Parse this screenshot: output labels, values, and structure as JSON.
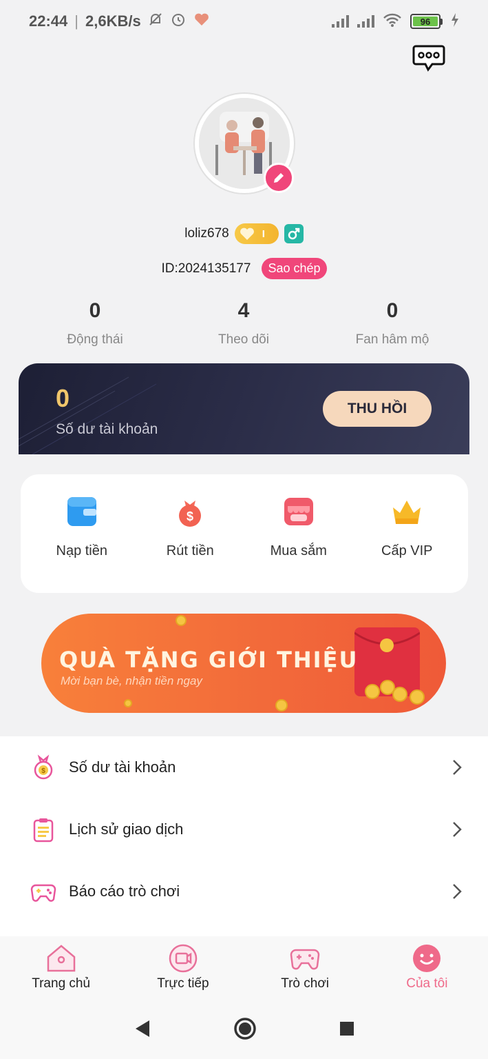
{
  "status_bar": {
    "time": "22:44",
    "network_speed": "2,6KB/s",
    "battery_level": "96",
    "icons": [
      "mute-bell-icon",
      "alarm-icon",
      "heart-icon",
      "signal-icon",
      "wifi-icon",
      "charging-icon"
    ]
  },
  "profile": {
    "username": "loliz678",
    "id_text": "ID:2024135177",
    "copy_label": "Sao chép",
    "level_label": "I"
  },
  "stats": [
    {
      "value": "0",
      "label": "Động thái"
    },
    {
      "value": "4",
      "label": "Theo dõi"
    },
    {
      "value": "0",
      "label": "Fan hâm mộ"
    }
  ],
  "balance": {
    "amount": "0",
    "label": "Số dư tài khoản",
    "withdraw_label": "THU HỒI"
  },
  "actions": [
    {
      "label": "Nạp tiền",
      "icon": "wallet-icon"
    },
    {
      "label": "Rút tiền",
      "icon": "money-bag-icon"
    },
    {
      "label": "Mua sắm",
      "icon": "shop-icon"
    },
    {
      "label": "Cấp VIP",
      "icon": "crown-icon"
    }
  ],
  "banner": {
    "title": "QUÀ TẶNG GIỚI THIỆU",
    "subtitle": "Mời bạn bè, nhận tiền ngay"
  },
  "menu": [
    {
      "label": "Số dư tài khoản",
      "icon": "money-bag-icon"
    },
    {
      "label": "Lịch sử giao dịch",
      "icon": "clipboard-icon"
    },
    {
      "label": "Báo cáo trò chơi",
      "icon": "gamepad-icon"
    }
  ],
  "bottom_nav": [
    {
      "label": "Trang chủ",
      "icon": "home-icon"
    },
    {
      "label": "Trực tiếp",
      "icon": "live-icon"
    },
    {
      "label": "Trò chơi",
      "icon": "gamepad-icon"
    },
    {
      "label": "Của tôi",
      "icon": "smiley-icon",
      "active": true
    }
  ],
  "colors": {
    "accent_pink": "#f0467a",
    "card_dark": "#1d1f35",
    "gold": "#f0c66b",
    "banner_orange": "#f26a3a"
  }
}
